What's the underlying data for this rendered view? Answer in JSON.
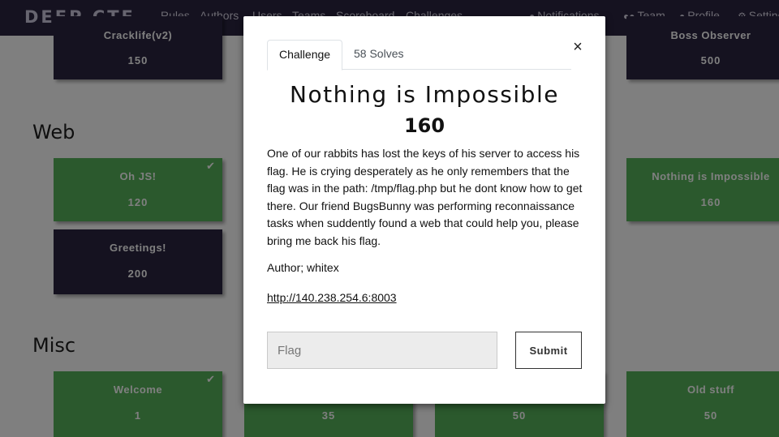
{
  "navbar": {
    "logo": "DEEP CTF",
    "links": [
      "Rules",
      "Authors",
      "Users",
      "Teams",
      "Scoreboard",
      "Challenges"
    ],
    "right": {
      "notifications": "Notifications",
      "team": "Team",
      "profile": "Profile",
      "settings": "Settings"
    }
  },
  "sections": {
    "web": "Web",
    "misc": "Misc"
  },
  "cards": {
    "top_left": {
      "name": "Cracklife(v2)",
      "value": "150"
    },
    "top_right": {
      "name": "Boss Observer",
      "value": "500"
    },
    "web_oh_js": {
      "name": "Oh JS!",
      "value": "120"
    },
    "web_greetings": {
      "name": "Greetings!",
      "value": "200"
    },
    "web_nothing": {
      "name": "Nothing is Impossible",
      "value": "160"
    },
    "misc_welcome": {
      "name": "Welcome",
      "value": "1"
    },
    "misc_2": {
      "name": "",
      "value": "35"
    },
    "misc_3": {
      "name": "",
      "value": "50"
    },
    "misc_old": {
      "name": "Old stuff",
      "value": "50"
    }
  },
  "modal": {
    "tabs": {
      "challenge": "Challenge",
      "solves": "58 Solves"
    },
    "close": "×",
    "title": "Nothing is Impossible",
    "value": "160",
    "description": "One of our rabbits has lost the keys of his server to access his flag. He is crying desperately as he only remembers that the flag was in the path: /tmp/flag.php but he dont know how to get there. Our friend BugsBunny was performing reconnaissance tasks when suddently found a web that could help you, please bring me back his flag.",
    "author": "Author; whitex",
    "link": "http://140.238.254.6:8003",
    "flag_placeholder": "Flag",
    "submit": "Submit"
  },
  "colors": {
    "navbar": "#2b2541",
    "unsolved_card": "#2b2541",
    "solved_card": "#57b35b"
  }
}
